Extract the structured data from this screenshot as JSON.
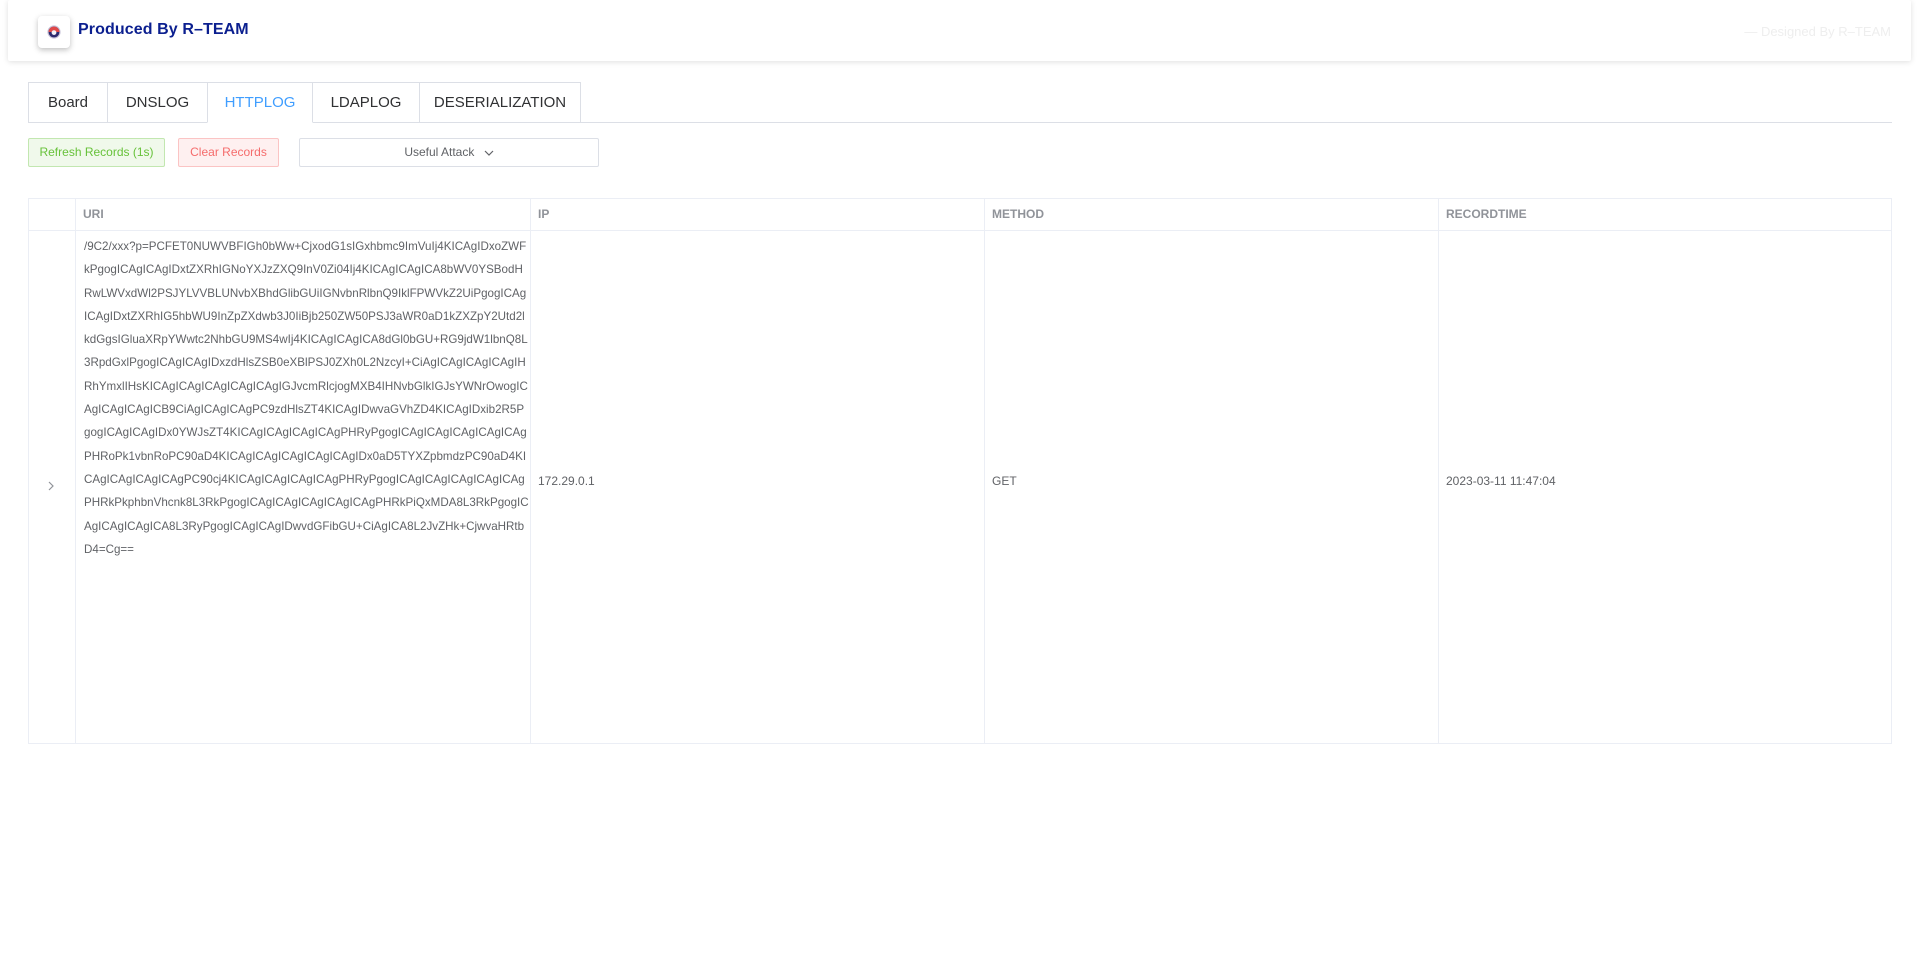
{
  "header": {
    "brand": "Produced By R–TEAM",
    "designed": "— Designed By R–TEAM"
  },
  "tabs": [
    {
      "label": "Board",
      "active": false
    },
    {
      "label": "DNSLOG",
      "active": false
    },
    {
      "label": "HTTPLOG",
      "active": true
    },
    {
      "label": "LDAPLOG",
      "active": false
    },
    {
      "label": "DESERIALIZATION",
      "active": false
    }
  ],
  "toolbar": {
    "refresh_label": "Refresh Records (1s)",
    "clear_label": "Clear Records",
    "attack_label": "Useful Attack"
  },
  "table": {
    "columns": [
      "URI",
      "IP",
      "METHOD",
      "RECORDTIME"
    ],
    "rows": [
      {
        "uri": "/9C2/xxx?p=PCFET0NUWVBFIGh0bWw+CjxodG1sIGxhbmc9ImVuIj4KICAgIDxoZWFkPgogICAgICAgIDxtZXRhIGNoYXJzZXQ9InV0Zi04Ij4KICAgICAgICA8bWV0YSBodHRwLWVxdWl2PSJYLVVBLUNvbXBhdGlibGUiIGNvbnRlbnQ9IklFPWVkZ2UiPgogICAgICAgIDxtZXRhIG5hbWU9InZpZXdwb3J0IiBjb250ZW50PSJ3aWR0aD1kZXZpY2Utd2lkdGgsIGluaXRpYWwtc2NhbGU9MS4wIj4KICAgICAgICA8dGl0bGU+RG9jdW1lbnQ8L3RpdGxlPgogICAgICAgIDxzdHlsZSB0eXBlPSJ0ZXh0L2NzcyI+CiAgICAgICAgICAgIHRhYmxlIHsKICAgICAgICAgICAgICAgIGJvcmRlcjogMXB4IHNvbGlkIGJsYWNrOwogICAgICAgICAgICB9CiAgICAgICAgPC9zdHlsZT4KICAgIDwvaGVhZD4KICAgIDxib2R5PgogICAgICAgIDx0YWJsZT4KICAgICAgICAgICAgPHRyPgogICAgICAgICAgICAgICAgPHRoPk1vbnRoPC90aD4KICAgICAgICAgICAgICAgIDx0aD5TYXZpbmdzPC90aD4KICAgICAgICAgICAgPC90cj4KICAgICAgICAgICAgPHRyPgogICAgICAgICAgICAgICAgPHRkPkphbnVhcnk8L3RkPgogICAgICAgICAgICAgICAgPHRkPiQxMDA8L3RkPgogICAgICAgICAgICA8L3RyPgogICAgICAgIDwvdGFibGU+CiAgICA8L2JvZHk+CjwvaHRtbD4=Cg==",
        "ip": "172.29.0.1",
        "method": "GET",
        "recordtime": "2023-03-11 11:47:04"
      }
    ]
  },
  "icons": {
    "logo": "logo-icon",
    "dropdown": "chevron-down-icon",
    "expand": "chevron-right-icon"
  }
}
